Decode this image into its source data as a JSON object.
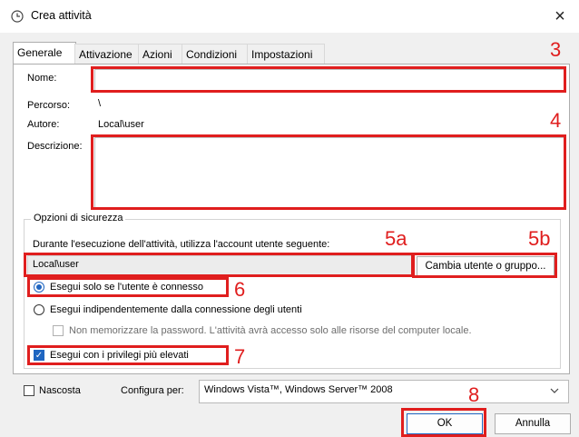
{
  "window": {
    "title": "Crea attività",
    "close": "×"
  },
  "tabs": [
    {
      "label": "Generale"
    },
    {
      "label": "Attivazione"
    },
    {
      "label": "Azioni"
    },
    {
      "label": "Condizioni"
    },
    {
      "label": "Impostazioni"
    }
  ],
  "general": {
    "name_label": "Nome:",
    "name_value": "",
    "path_label": "Percorso:",
    "path_value": "\\",
    "author_label": "Autore:",
    "author_value": "Local\\user",
    "description_label": "Descrizione:",
    "description_value": ""
  },
  "security": {
    "group_title": "Opzioni di sicurezza",
    "account_prompt": "Durante l'esecuzione dell'attività, utilizza l'account utente seguente:",
    "account_value": "Local\\user",
    "change_user_button": "Cambia utente o gruppo...",
    "radio_logged_on": {
      "label": "Esegui solo se l'utente è connesso",
      "selected": true
    },
    "radio_always": {
      "label": "Esegui indipendentemente dalla connessione degli utenti",
      "selected": false
    },
    "do_not_store_password": {
      "label": "Non memorizzare la password. L'attività avrà accesso solo alle risorse del computer locale.",
      "checked": false,
      "enabled": false
    },
    "highest_privileges": {
      "label": "Esegui con i privilegi più elevati",
      "checked": true
    }
  },
  "footer": {
    "hidden_label": "Nascosta",
    "hidden_checked": false,
    "configure_label": "Configura per:",
    "configure_value": "Windows Vista™, Windows Server™ 2008",
    "ok_button": "OK",
    "cancel_button": "Annulla"
  },
  "annotations": [
    "3",
    "4",
    "5a",
    "5b",
    "6",
    "7",
    "8"
  ],
  "colors": {
    "annotation_red": "#e01e1e",
    "accent_blue": "#1f66c1"
  }
}
